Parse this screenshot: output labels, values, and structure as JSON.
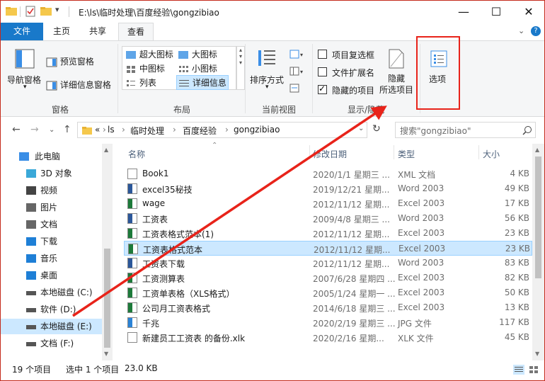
{
  "titlebar": {
    "path": "E:\\ls\\临时处理\\百度经验\\gongzibiao",
    "minimize_icon": "—",
    "maximize_icon": "☐",
    "close_icon": "✕"
  },
  "tabs": {
    "file": "文件",
    "home": "主页",
    "share": "共享",
    "view": "查看",
    "help_icon": "?"
  },
  "ribbon": {
    "pane": {
      "nav_pane": "导航窗格",
      "preview_pane": "预览窗格",
      "details_pane": "详细信息窗格",
      "group": "窗格"
    },
    "layout": {
      "xlarge": "超大图标",
      "large": "大图标",
      "medium": "中图标",
      "small": "小图标",
      "list": "列表",
      "details": "详细信息",
      "group": "布局"
    },
    "current_view": {
      "sort_by": "排序方式",
      "group": "当前视图"
    },
    "show_hide": {
      "item_checkboxes": "项目复选框",
      "file_extensions": "文件扩展名",
      "hidden_items": "隐藏的项目",
      "hide_selected_line1": "隐藏",
      "hide_selected_line2": "所选项目",
      "group": "显示/隐藏"
    },
    "options": "选项"
  },
  "address": {
    "crumbs": [
      "«",
      "ls",
      "临时处理",
      "百度经验",
      "gongzibiao"
    ],
    "search_placeholder": "搜索\"gongzibiao\""
  },
  "nav_tree": [
    {
      "label": "此电脑",
      "icon": "computer-icon",
      "color": "#3a8ee6"
    },
    {
      "label": "3D 对象",
      "icon": "3d-objects-icon",
      "color": "#3aa8d8"
    },
    {
      "label": "视频",
      "icon": "video-icon",
      "color": "#444"
    },
    {
      "label": "图片",
      "icon": "pictures-icon",
      "color": "#666"
    },
    {
      "label": "文档",
      "icon": "documents-icon",
      "color": "#666"
    },
    {
      "label": "下载",
      "icon": "downloads-icon",
      "color": "#1e7fd6"
    },
    {
      "label": "音乐",
      "icon": "music-icon",
      "color": "#1e7fd6"
    },
    {
      "label": "桌面",
      "icon": "desktop-icon",
      "color": "#1e7fd6"
    },
    {
      "label": "本地磁盘 (C:)",
      "icon": "drive-icon",
      "color": "#555"
    },
    {
      "label": "软件 (D:)",
      "icon": "drive-icon",
      "color": "#555"
    },
    {
      "label": "本地磁盘 (E:)",
      "icon": "drive-icon",
      "color": "#555"
    },
    {
      "label": "文档 (F:)",
      "icon": "drive-icon",
      "color": "#555"
    }
  ],
  "columns": {
    "name": "名称",
    "date": "修改日期",
    "type": "类型",
    "size": "大小"
  },
  "files": [
    {
      "name": "Book1",
      "date": "2020/1/1 星期三 ...",
      "type": "XML 文档",
      "size": "4 KB",
      "icon": "xml-file-icon"
    },
    {
      "name": "excel35秘技",
      "date": "2019/12/21 星期...",
      "type": "Word 2003",
      "size": "49 KB",
      "icon": "word-file-icon"
    },
    {
      "name": "wage",
      "date": "2012/11/12 星期...",
      "type": "Excel 2003",
      "size": "17 KB",
      "icon": "excel-file-icon"
    },
    {
      "name": "工资表",
      "date": "2009/4/8 星期三 ...",
      "type": "Word 2003",
      "size": "56 KB",
      "icon": "word-file-icon"
    },
    {
      "name": "工资表格式范本(1)",
      "date": "2012/11/12 星期...",
      "type": "Excel 2003",
      "size": "23 KB",
      "icon": "excel-file-icon"
    },
    {
      "name": "工资表格式范本",
      "date": "2012/11/12 星期...",
      "type": "Excel 2003",
      "size": "23 KB",
      "icon": "excel-file-icon"
    },
    {
      "name": "工资表下载",
      "date": "2012/11/12 星期...",
      "type": "Word 2003",
      "size": "83 KB",
      "icon": "word-file-icon"
    },
    {
      "name": "工资测算表",
      "date": "2007/6/28 星期四 ...",
      "type": "Excel 2003",
      "size": "82 KB",
      "icon": "excel-file-icon"
    },
    {
      "name": "工资单表格（XLS格式）",
      "date": "2005/1/24 星期一 ...",
      "type": "Excel 2003",
      "size": "50 KB",
      "icon": "excel-file-icon"
    },
    {
      "name": "公司月工资表格式",
      "date": "2014/6/18 星期三 ...",
      "type": "Excel 2003",
      "size": "13 KB",
      "icon": "excel-file-icon"
    },
    {
      "name": "千兆",
      "date": "2020/2/19 星期三 ...",
      "type": "JPG 文件",
      "size": "117 KB",
      "icon": "image-file-icon"
    },
    {
      "name": "新建员工工资表 的备份.xlk",
      "date": "2020/2/16 星期...",
      "type": "XLK 文件",
      "size": "45 KB",
      "icon": "file-icon"
    }
  ],
  "status": {
    "count": "19 个项目",
    "selected": "选中 1 个项目",
    "size": "23.0 KB"
  },
  "colors": {
    "accent": "#1979ca",
    "selection": "#cce8ff",
    "annotation_red": "#e8231a"
  }
}
